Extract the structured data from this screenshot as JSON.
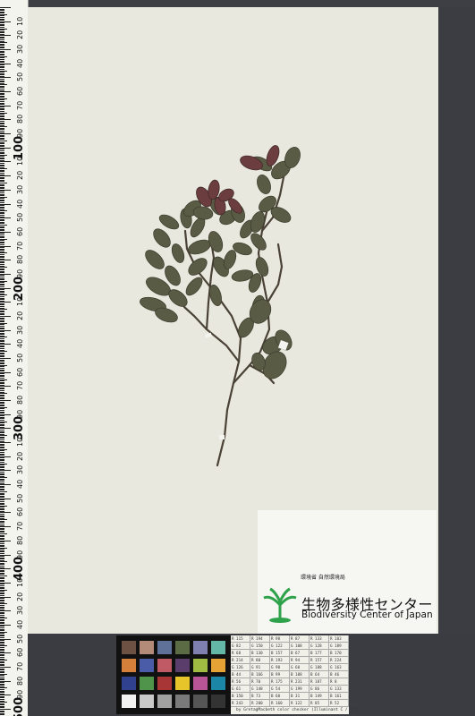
{
  "ruler": {
    "numbers": [
      "10",
      "20",
      "30",
      "40",
      "50",
      "60",
      "70",
      "80",
      "90",
      "10",
      "20",
      "30",
      "40",
      "50",
      "60",
      "70",
      "80",
      "90",
      "20",
      "20",
      "30",
      "40",
      "50",
      "60",
      "70",
      "80",
      "90",
      "300",
      "10",
      "20",
      "30",
      "40",
      "50",
      "60",
      "70",
      "80",
      "90",
      "400",
      "10",
      "20",
      "30",
      "40",
      "50",
      "60",
      "70",
      "80",
      "90",
      "500"
    ],
    "big_labels": [
      "100",
      "200",
      "300",
      "400",
      "500"
    ]
  },
  "label": {
    "agency": "環境省 自然環境局",
    "title_ja": "生物多様性センター",
    "title_en": "Biodiversity Center of Japan"
  },
  "color_checker": {
    "rows": [
      [
        "#6d5142",
        "#b48a78",
        "#5f7199",
        "#5b6b43",
        "#7f80b0",
        "#63b7a7"
      ],
      [
        "#d4803a",
        "#4a5ca8",
        "#c05a65",
        "#5a3d6a",
        "#9fbb41",
        "#e4a334"
      ],
      [
        "#30428f",
        "#4f944a",
        "#a83637",
        "#e5c52a",
        "#b75597",
        "#1c86a7"
      ],
      [
        "#f2f2f2",
        "#c9c9c9",
        "#a1a1a1",
        "#7a7a7a",
        "#555555",
        "#333333"
      ]
    ]
  },
  "target_table": {
    "rows": [
      [
        "R 115",
        "R 194",
        "R 98",
        "R 87",
        "R 133",
        "R 103"
      ],
      [
        "G 82",
        "G 150",
        "G 122",
        "G 108",
        "G 128",
        "G 189"
      ],
      [
        "R 68",
        "B 130",
        "B 157",
        "B 67",
        "B 177",
        "B 170"
      ],
      [
        "R 214",
        "R 80",
        "R 193",
        "R 94",
        "R 157",
        "R 224"
      ],
      [
        "G 126",
        "G 91",
        "G 90",
        "G 60",
        "G 188",
        "G 163"
      ],
      [
        "B 44",
        "B 166",
        "B 99",
        "B 108",
        "B 64",
        "B 46"
      ],
      [
        "R 56",
        "R 70",
        "R 175",
        "R 231",
        "R 187",
        "R 8"
      ],
      [
        "G 61",
        "G 148",
        "G 54",
        "G 199",
        "G 86",
        "G 133"
      ],
      [
        "B 150",
        "B 73",
        "B 60",
        "B 31",
        "B 149",
        "B 161"
      ],
      [
        "R 243",
        "R 200",
        "R 160",
        "R 122",
        "R 85",
        "R 52"
      ]
    ],
    "caption": "by GretagMacbeth color checker (Illuminant C / 2°)"
  }
}
